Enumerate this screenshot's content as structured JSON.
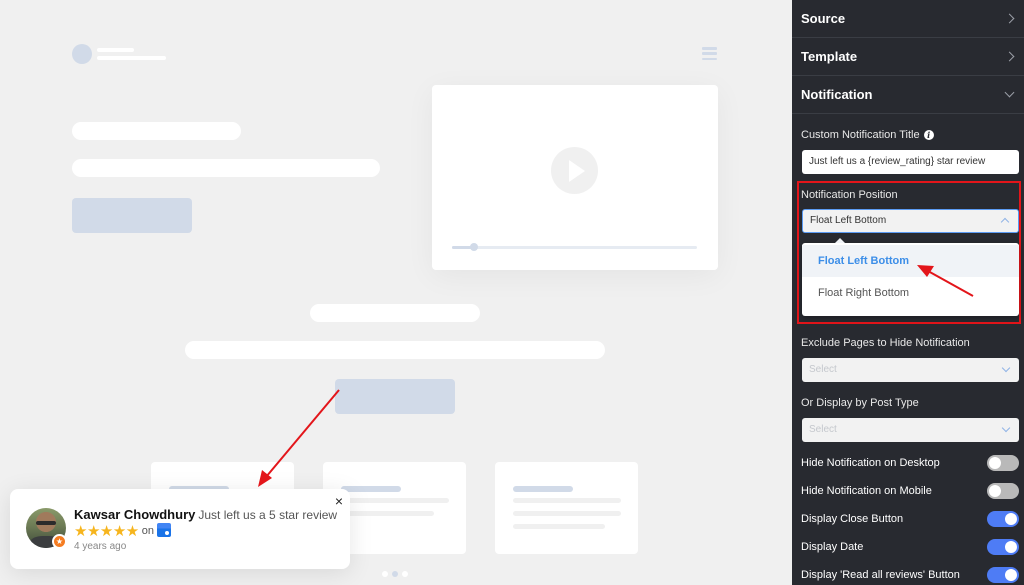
{
  "preview": {
    "slider_progress": 0.09,
    "carousel_dots": 3,
    "carousel_active_index": 1
  },
  "notification_popup": {
    "reviewer_name": "Kawsar Chowdhury",
    "message": "Just left us a 5 star review",
    "rating": 5,
    "stars_text": "★★★★★",
    "on_label": "on",
    "platform_icon": "google-my-business-icon",
    "time_ago": "4 years ago",
    "close_icon": "×",
    "badge_icon": "★"
  },
  "sidebar": {
    "sections": [
      {
        "label": "Source",
        "expanded": false
      },
      {
        "label": "Template",
        "expanded": false
      },
      {
        "label": "Notification",
        "expanded": true
      }
    ],
    "custom_title": {
      "label": "Custom Notification Title",
      "info_icon": "i",
      "value": "Just left us a {review_rating} star review"
    },
    "position": {
      "label": "Notification Position",
      "selected": "Float Left Bottom",
      "options": [
        "Float Left Bottom",
        "Float Right Bottom"
      ]
    },
    "exclude_pages": {
      "label": "Exclude Pages to Hide Notification",
      "placeholder": "Select"
    },
    "post_type": {
      "label": "Or Display by Post Type",
      "placeholder": "Select"
    },
    "toggles": [
      {
        "label": "Hide Notification on Desktop",
        "on": false
      },
      {
        "label": "Hide Notification on Mobile",
        "on": false
      },
      {
        "label": "Display Close Button",
        "on": true
      },
      {
        "label": "Display Date",
        "on": true
      },
      {
        "label": "Display 'Read all reviews' Button",
        "on": true
      }
    ]
  },
  "colors": {
    "sidebar_bg": "#282a30",
    "toggle_on": "#4e7cf5",
    "toggle_off": "#b9b9b9",
    "selected_option": "#3c8ee8",
    "annotation_red": "#e3151a",
    "star": "#f6b51e"
  }
}
